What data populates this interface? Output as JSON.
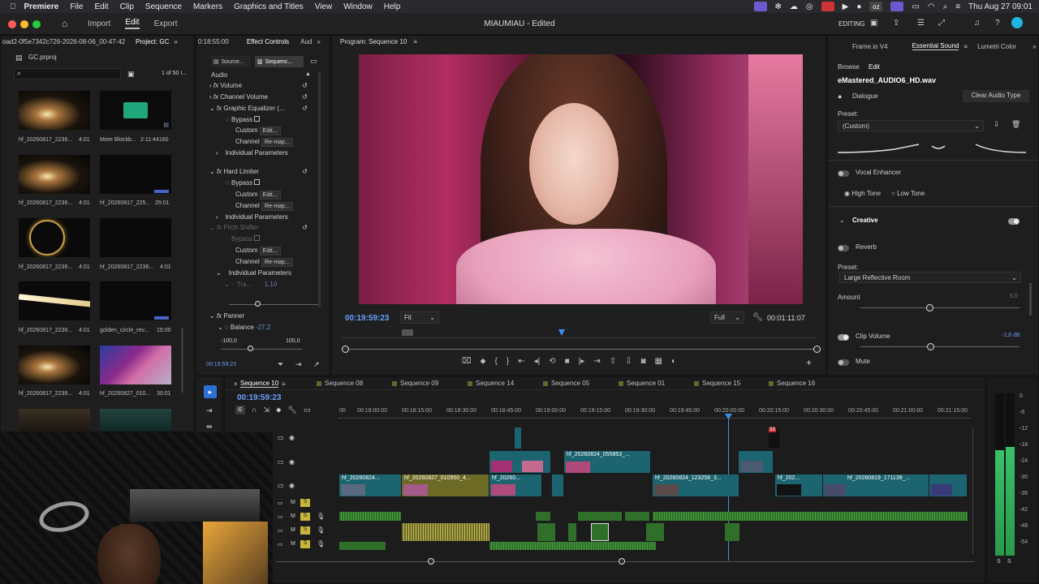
{
  "menubar": {
    "app": "Premiere",
    "items": [
      "File",
      "Edit",
      "Clip",
      "Sequence",
      "Markers",
      "Graphics and Titles",
      "View",
      "Window",
      "Help"
    ],
    "clock": "Thu Aug 27  09:01"
  },
  "titlebar": {
    "tabs": [
      "Import",
      "Edit",
      "Export"
    ],
    "active_tab": "Edit",
    "title": "MIAUMIAU - Edited",
    "workspace": "EDITING"
  },
  "project": {
    "path": "oad2-0f5e7342c726-2026-08-06_00-47-42",
    "tab": "Project: GC",
    "file": "GC.prproj",
    "count": "1 of 50 I...",
    "items": [
      {
        "name": "hf_20260817_2236...",
        "dur": "4:01"
      },
      {
        "name": "More Blockb...",
        "dur": "2:11:44160"
      },
      {
        "name": "hf_20260817_2236...",
        "dur": "4:01"
      },
      {
        "name": "hf_20260817_225...",
        "dur": "25:01"
      },
      {
        "name": "hf_20260817_2236...",
        "dur": "4:01"
      },
      {
        "name": "hf_20260817_2236...",
        "dur": "4:01"
      },
      {
        "name": "hf_20260817_2236...",
        "dur": "4:01"
      },
      {
        "name": "golden_circle_rev...",
        "dur": "15:00"
      },
      {
        "name": "hf_20260817_2236...",
        "dur": "4:01"
      },
      {
        "name": "hf_20260827_010...",
        "dur": "30:01"
      }
    ]
  },
  "effect_controls": {
    "tc_left": "0:18:55:00",
    "tab": "Effect Controls",
    "tab2": "Aud",
    "source_btn": "Source...",
    "seq_btn": "Sequenc...",
    "section": "Audio",
    "volume": "Volume",
    "channel_volume": "Channel Volume",
    "geq": "Graphic Equalizer (...",
    "bypass": "Bypass",
    "custom": "Custom",
    "edit": "Edit...",
    "channel": "Channel",
    "remap": "Re-map...",
    "indiv": "Individual Parameters",
    "hard_limiter": "Hard Limiter",
    "pitch": "Pitch Shifter",
    "tra": "Tra...",
    "tra_val": "1,10",
    "panner": "Panner",
    "balance": "Balance",
    "balance_val": "-27,2",
    "min": "-100,0",
    "max": "100,0",
    "timecode": "00:19:59:23"
  },
  "program": {
    "title": "Program: Sequence 10",
    "timecode": "00:19:59:23",
    "fit": "Fit",
    "quality": "Full",
    "duration": "00:01:11:07"
  },
  "essential_sound": {
    "tabs": [
      "Frame.io V4",
      "Essential Sound",
      "Lumetri Color"
    ],
    "subtabs": [
      "Browse",
      "Edit"
    ],
    "file": "eMastered_AUDIO6_HD.wav",
    "type": "Dialogue",
    "clear": "Clear Audio Type",
    "preset_label": "Preset:",
    "preset": "(Custom)",
    "vocal": "Vocal Enhancer",
    "high": "High Tone",
    "low": "Low Tone",
    "creative": "Creative",
    "reverb": "Reverb",
    "preset2": "Large Reflective Room",
    "amount": "Amount",
    "amount_val": "5,0",
    "clip_volume": "Clip Volume",
    "clip_volume_val": "-2,8 dB",
    "mute": "Mute"
  },
  "timeline": {
    "tabs": [
      "Sequence 10",
      "Sequence 08",
      "Sequence 09",
      "Sequence 14",
      "Sequence 05",
      "Sequence 01",
      "Sequence 15",
      "Sequence 16"
    ],
    "timecode": "00:19:59:23",
    "ruler": [
      "00:18:00:00",
      "00:18:15:00",
      "00:18:30:00",
      "00:18:45:00",
      "00:19:00:00",
      "00:19:15:00",
      "00:19:30:00",
      "00:19:45:00",
      "00:20:00:00",
      "00:20:15:00",
      "00:20:30:00",
      "00:20:45:00",
      "00:21:00:00",
      "00:21:15:00"
    ],
    "ruler_start": "00",
    "clips": [
      "hf_20260824...",
      "hf_20260827_010950_4...",
      "hf_20260...",
      "hf_20260824_055853_...",
      "hf_20260824_123258_3...",
      "hf_202...",
      "hf_20260819_171139_..."
    ],
    "badge": "33",
    "meter": [
      "0",
      "-6",
      "-12",
      "-18",
      "-24",
      "-30",
      "-36",
      "-42",
      "-48",
      "-54"
    ],
    "meter_foot": [
      "S",
      "S"
    ],
    "track_s": "S",
    "track_m": "M"
  }
}
